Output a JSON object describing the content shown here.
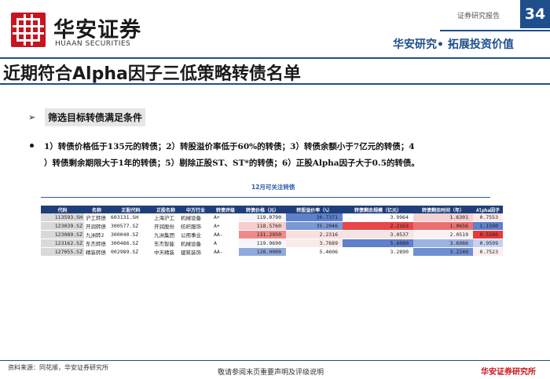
{
  "header": {
    "brand_cn": "华安证券",
    "brand_en": "HUAAN SECURITIES",
    "report_type": "证券研究报告",
    "page_number": "34",
    "slogan": "华安研究• 拓展投资价值"
  },
  "title": "近期符合Alpha因子三低策略转债名单",
  "section": {
    "arrow": "➢",
    "heading": "筛选目标转债满足条件",
    "conditions_line1": "1）转债价格低于135元的转债；2）转股溢价率低于60%的转债；3）转债余额小于7亿元的转债；4",
    "conditions_line2": "）转债剩余期限大于1年的转债；5）剔除正股ST、ST*的转债；6）正股Alpha因子大于0.5的转债。"
  },
  "table": {
    "title": "12月可关注转债",
    "columns": [
      "代码",
      "名称",
      "正股代码",
      "正股名称",
      "中万行业",
      "转债评级",
      "转债价格（元）",
      "转股溢价率（%）",
      "转债剩余规模（亿元）",
      "转债剩余时间（年）",
      "Alpha因子"
    ],
    "rows": [
      {
        "code": "113593.SH",
        "name": "沪工转债",
        "stock_code": "603131.SH",
        "stock_name": "上海沪工",
        "industry": "机械设备",
        "rating": "A+",
        "price": "119.0790",
        "premium": "30.7371",
        "balance": "3.9964",
        "remaining": "1.6301",
        "alpha": "0.7553"
      },
      {
        "code": "123039.SZ",
        "name": "开润转债",
        "stock_code": "300577.SZ",
        "stock_name": "开润股份",
        "industry": "纺织服饰",
        "rating": "A+",
        "price": "118.5760",
        "premium": "35.2046",
        "balance": "2.2163",
        "remaining": "1.0656",
        "alpha": "1.1590"
      },
      {
        "code": "123089.SZ",
        "name": "九洲转2",
        "stock_code": "300040.SZ",
        "stock_name": "九洲集团",
        "industry": "公用事业",
        "rating": "AA-",
        "price": "131.2950",
        "premium": "2.2316",
        "balance": "3.0537",
        "remaining": "2.0519",
        "alpha": "0.5286"
      },
      {
        "code": "123162.SZ",
        "name": "东杰转债",
        "stock_code": "300486.SZ",
        "stock_name": "东杰智能",
        "industry": "机械设备",
        "rating": "A",
        "price": "119.9690",
        "premium": "3.7689",
        "balance": "5.6080",
        "remaining": "3.6986",
        "alpha": "0.9599"
      },
      {
        "code": "127055.SZ",
        "name": "精装转债",
        "stock_code": "002989.SZ",
        "stock_name": "中天精装",
        "industry": "建筑装饰",
        "rating": "AA-",
        "price": "128.0000",
        "premium": "5.4606",
        "balance": "3.2890",
        "remaining": "3.2240",
        "alpha": "0.7523"
      }
    ],
    "cell_colors": {
      "price": [
        "#f3f5fb",
        "#f6cccc",
        "#f08a8a",
        "#f4f6fb",
        "#8fa9dc"
      ],
      "premium": [
        "#5f80cb",
        "#7a97d6",
        "#f9e0e0",
        "#fbeaea",
        "#ffffff"
      ],
      "balance": [
        "#ffffff",
        "#e8474a",
        "#f7e4e4",
        "#5f80cb",
        "#ffffff"
      ],
      "remaining": [
        "#f5d2d2",
        "#ec6f6f",
        "#fbf1f1",
        "#9bb2e2",
        "#6f8fd3"
      ],
      "alpha": [
        "#fbeaea",
        "#5f80cb",
        "#e53b3b",
        "#c4d2ef",
        "#fbeeee"
      ]
    }
  },
  "footer": {
    "source": "资料来源：同花顺，华安证券研究所",
    "disclaimer": "敬请参阅末页重要声明及评级说明",
    "brand": "华安证券研究所"
  }
}
